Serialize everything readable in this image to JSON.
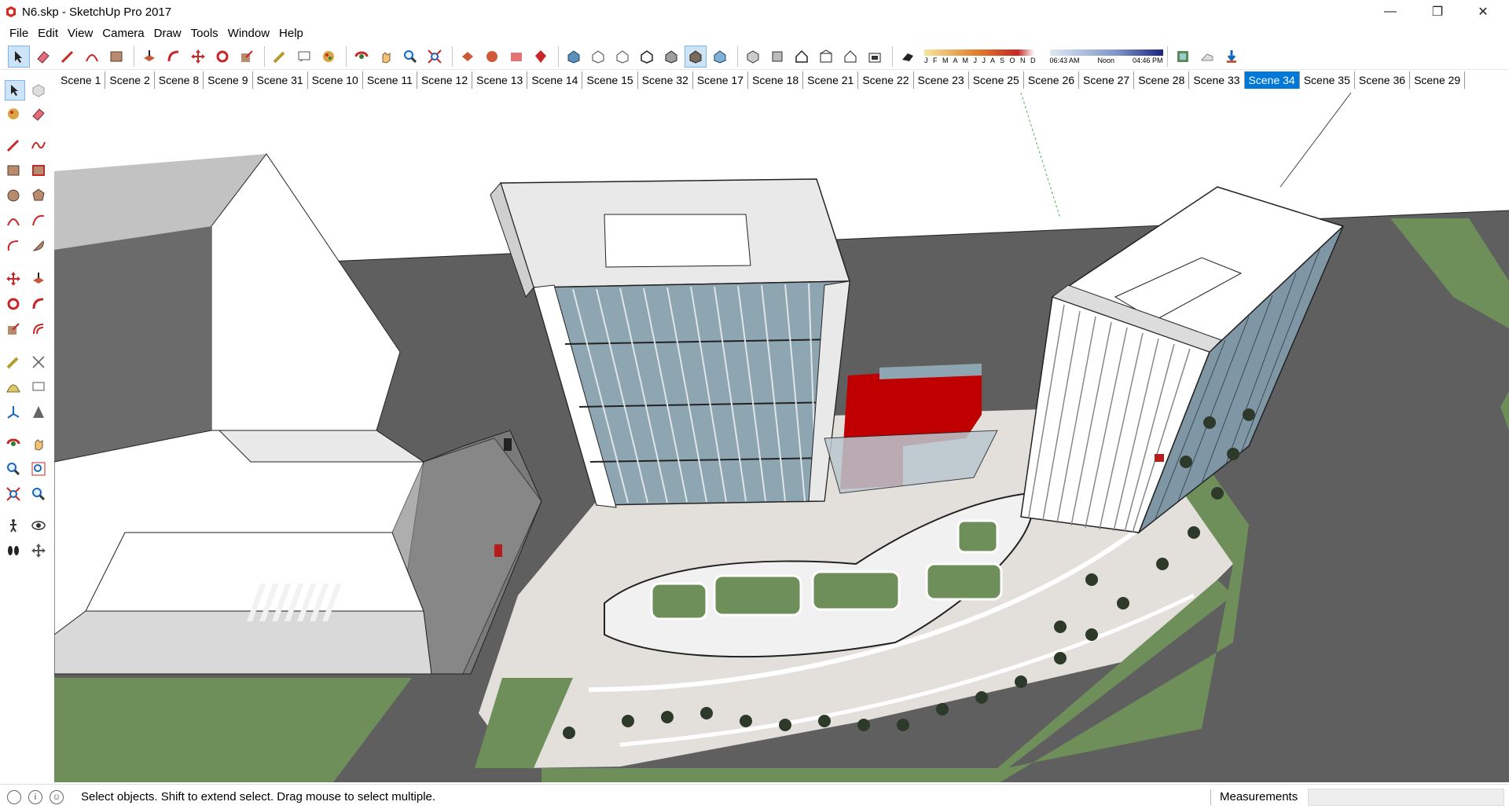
{
  "window": {
    "title": "N6.skp - SketchUp Pro 2017",
    "minimize": "—",
    "maximize": "❐",
    "close": "✕"
  },
  "menu": [
    "File",
    "Edit",
    "View",
    "Camera",
    "Draw",
    "Tools",
    "Window",
    "Help"
  ],
  "shadow": {
    "months": "J F M A M J J A S O N D",
    "sunrise": "06:43 AM",
    "noon": "Noon",
    "sunset": "04:46 PM"
  },
  "scenes": [
    "Scene 1",
    "Scene 2",
    "Scene 8",
    "Scene 9",
    "Scene 31",
    "Scene 10",
    "Scene 11",
    "Scene 12",
    "Scene 13",
    "Scene 14",
    "Scene 15",
    "Scene 32",
    "Scene 17",
    "Scene 18",
    "Scene 21",
    "Scene 22",
    "Scene 23",
    "Scene 25",
    "Scene 26",
    "Scene 27",
    "Scene 28",
    "Scene 33",
    "Scene 34",
    "Scene 35",
    "Scene 36",
    "Scene 29"
  ],
  "active_scene": "Scene 34",
  "status": {
    "message": "Select objects. Shift to extend select. Drag mouse to select multiple.",
    "measurements_label": "Measurements",
    "measurements_value": ""
  },
  "colors": {
    "accent": "#0078d7",
    "ground": "#5c5c5c",
    "grass": "#6f8f5a",
    "glass": "#8ea6b2",
    "red": "#c00000"
  }
}
